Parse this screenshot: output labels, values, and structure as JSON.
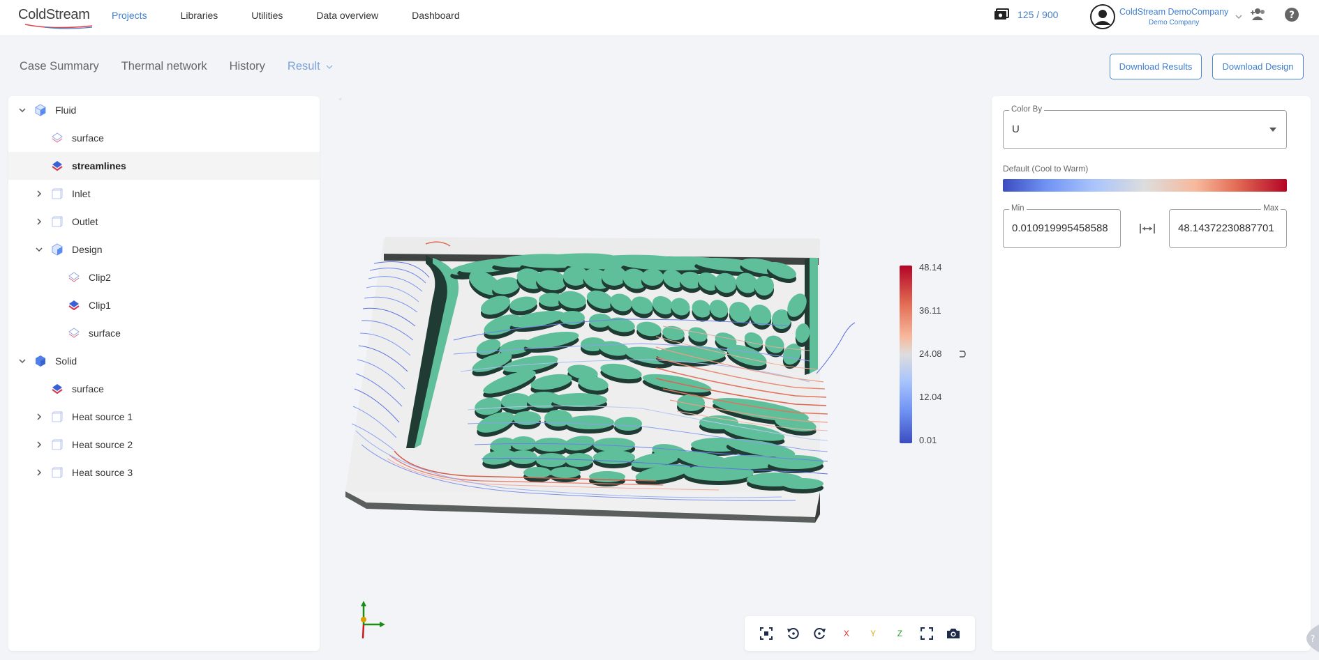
{
  "brand": {
    "name": "ColdStream"
  },
  "nav": {
    "items": [
      {
        "label": "Projects",
        "active": true
      },
      {
        "label": "Libraries"
      },
      {
        "label": "Utilities"
      },
      {
        "label": "Data overview"
      },
      {
        "label": "Dashboard"
      }
    ]
  },
  "header": {
    "credits": "125 / 900",
    "user_name": "ColdStream DemoCompany",
    "user_company": "Demo Company"
  },
  "subnav": {
    "items": [
      {
        "label": "Case Summary"
      },
      {
        "label": "Thermal network"
      },
      {
        "label": "History"
      },
      {
        "label": "Result",
        "active": true
      }
    ],
    "download_results": "Download Results",
    "download_design": "Download Design"
  },
  "tree": {
    "items": [
      {
        "label": "Fluid",
        "level": 0,
        "expanded": true
      },
      {
        "label": "surface",
        "level": 1
      },
      {
        "label": "streamlines",
        "level": 1,
        "selected": true
      },
      {
        "label": "Inlet",
        "level": 1,
        "collapsed": true
      },
      {
        "label": "Outlet",
        "level": 1,
        "collapsed": true
      },
      {
        "label": "Design",
        "level": 1,
        "expanded": true
      },
      {
        "label": "Clip2",
        "level": 2
      },
      {
        "label": "Clip1",
        "level": 2
      },
      {
        "label": "surface",
        "level": 2
      },
      {
        "label": "Solid",
        "level": 0,
        "expanded": true
      },
      {
        "label": "surface",
        "level": 1
      },
      {
        "label": "Heat source 1",
        "level": 1,
        "collapsed": true
      },
      {
        "label": "Heat source 2",
        "level": 1,
        "collapsed": true
      },
      {
        "label": "Heat source 3",
        "level": 1,
        "collapsed": true
      }
    ]
  },
  "legend": {
    "ticks": [
      "48.14",
      "36.11",
      "24.08",
      "12.04",
      "0.01"
    ]
  },
  "toolbar": {
    "x_label": "X",
    "y_label": "Y",
    "z_label": "Z"
  },
  "panel": {
    "color_by_label": "Color By",
    "color_by_value": "U",
    "colormap_name": "Default (Cool to Warm)",
    "min_label": "Min",
    "min_value": "0.010919995458588",
    "max_label": "Max",
    "max_value": "48.14372230887701"
  },
  "colors": {
    "accent": "#3f7fd0",
    "fin": "#5fbf9a",
    "fin_dark": "#1f3b33"
  }
}
